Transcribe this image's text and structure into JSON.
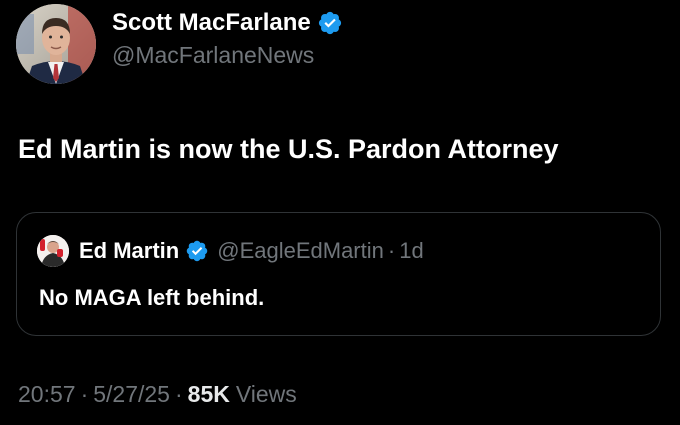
{
  "author": {
    "display_name": "Scott MacFarlane",
    "handle": "@MacFarlaneNews",
    "avatar": "profile-photo",
    "verified_icon": "verified-badge-icon"
  },
  "tweet": {
    "text": "Ed Martin is now the U.S. Pardon Attorney"
  },
  "quoted_tweet": {
    "display_name": "Ed Martin",
    "handle": "@EagleEdMartin",
    "separator": "·",
    "time": "1d",
    "text": "No MAGA left behind.",
    "avatar": "profile-photo",
    "verified_icon": "verified-badge-icon"
  },
  "meta": {
    "time": "20:57",
    "separator": "·",
    "date": "5/27/25",
    "views_count": "85K",
    "views_label": "Views"
  },
  "colors": {
    "background": "#000000",
    "primary_text": "#e7e9ea",
    "secondary_text": "#71767b",
    "verified": "#1d9bf0",
    "border": "#2f3336"
  }
}
